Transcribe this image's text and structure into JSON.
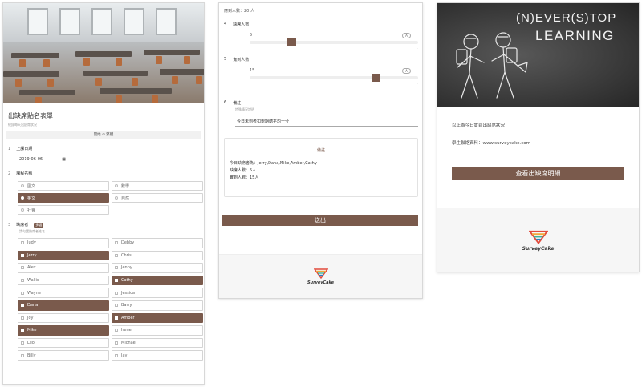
{
  "form": {
    "title": "出缺席點名表單",
    "subtitle": "紀錄每天出缺席狀況",
    "language_label": "開始 ⊙ 繁體",
    "q1": {
      "num": "1",
      "label": "上課日期",
      "date_value": "2019-06-06",
      "calendar_icon": "calendar-icon"
    },
    "q2": {
      "num": "2",
      "label": "課程名稱",
      "options": [
        {
          "label": "國文",
          "selected": false
        },
        {
          "label": "數學",
          "selected": false
        },
        {
          "label": "英文",
          "selected": true
        },
        {
          "label": "自然",
          "selected": false
        },
        {
          "label": "社會",
          "selected": false
        }
      ]
    },
    "q3": {
      "num": "3",
      "label": "缺席者",
      "badge": "多選",
      "hint": "請勾選缺席者姓名",
      "options": [
        {
          "label": "Judy",
          "selected": false
        },
        {
          "label": "Debby",
          "selected": false
        },
        {
          "label": "Jerry",
          "selected": true
        },
        {
          "label": "Chris",
          "selected": false
        },
        {
          "label": "Alex",
          "selected": false
        },
        {
          "label": "Jenny",
          "selected": false
        },
        {
          "label": "Wallis",
          "selected": false
        },
        {
          "label": "Cathy",
          "selected": true
        },
        {
          "label": "Wayne",
          "selected": false
        },
        {
          "label": "Jessica",
          "selected": false
        },
        {
          "label": "Dana",
          "selected": true
        },
        {
          "label": "Barry",
          "selected": false
        },
        {
          "label": "Joy",
          "selected": false
        },
        {
          "label": "Amber",
          "selected": true
        },
        {
          "label": "Mike",
          "selected": true
        },
        {
          "label": "Irene",
          "selected": false
        },
        {
          "label": "Leo",
          "selected": false
        },
        {
          "label": "Michael",
          "selected": false
        },
        {
          "label": "Billy",
          "selected": false
        },
        {
          "label": "Jay",
          "selected": false
        }
      ]
    }
  },
  "panel2": {
    "total": "應到人數：20 人",
    "q4": {
      "num": "4",
      "label": "缺席人數",
      "value": "5",
      "bubble": "A",
      "fraction": 0.25
    },
    "q5": {
      "num": "5",
      "label": "實到人數",
      "value": "15",
      "bubble": "A",
      "fraction": 0.75
    },
    "q6": {
      "num": "6",
      "label": "備註",
      "hint": "特殊情況說明",
      "value": "今日未到者扣學期總平均一分"
    },
    "summary": {
      "title": "備註",
      "line1": "今日缺席者為：Jerry,Dana,Mike,Amber,Cathy",
      "line2": "缺席人數：5人",
      "line3": "實到人數：15人"
    },
    "submit_label": "送出",
    "brand": "SurveyCake"
  },
  "panel3": {
    "board_line1": "(N)EVER(S)TOP",
    "board_line2": "LEARNING",
    "message": "以上為今日實到出缺席狀況",
    "contact": "學生聯絡資料：www.surveycake.com",
    "button_label": "查看出缺席明細",
    "brand": "SurveyCake"
  },
  "colors": {
    "accent": "#7a5a4c",
    "border": "#d4d4d4"
  }
}
